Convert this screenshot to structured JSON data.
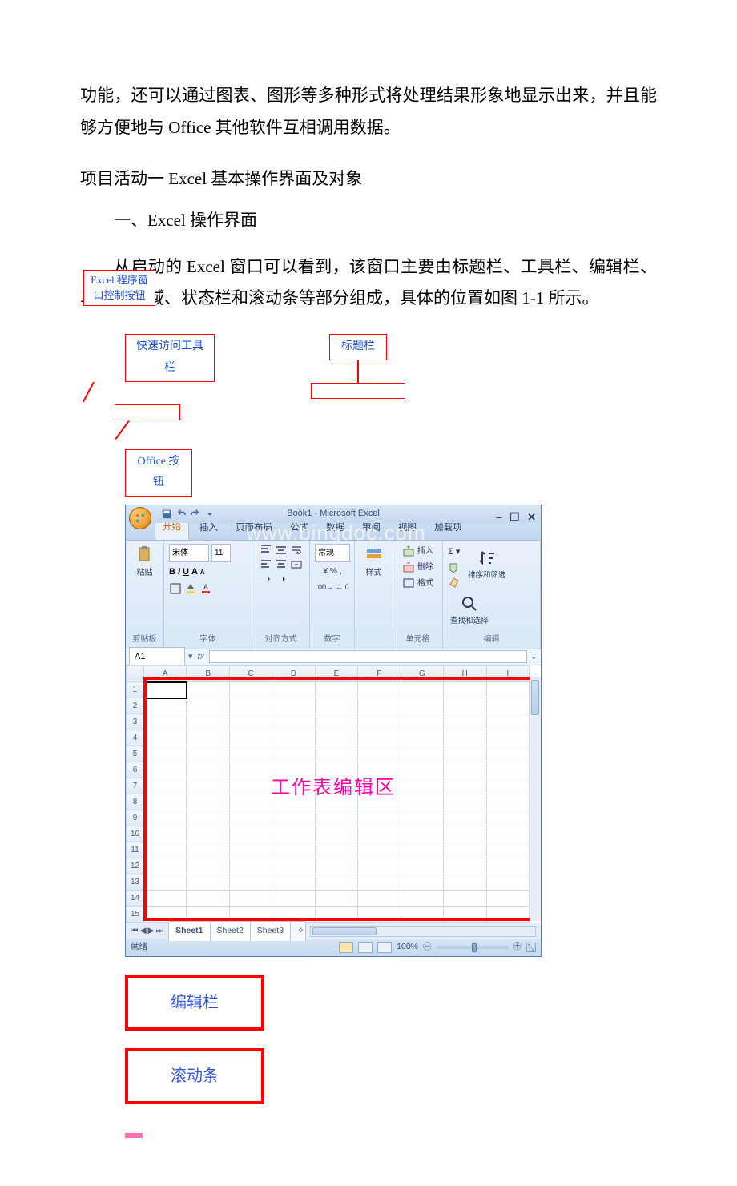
{
  "para1": "功能，还可以通过图表、图形等多种形式将处理结果形象地显示出来，并且能够方便地与 Office 其他软件互相调用数据。",
  "h1": "项目活动一 Excel 基本操作界面及对象",
  "h2": "一、Excel 操作界面",
  "para2": "从启动的 Excel 窗口可以看到，该窗口主要由标题栏、工具栏、编辑栏、单元格区域、状态栏和滚动条等部分组成，具体的位置如图 1-1 所示。",
  "annotations": {
    "program_ctrl": [
      "Excel 程序窗",
      "口控制按钮"
    ],
    "qat": "快速访问工具栏",
    "title": "标题栏",
    "office_btn": "Office 按钮",
    "edit_area": "工作表编辑区",
    "formula_bar": "编辑栏",
    "scrollbar": "滚动条"
  },
  "excel": {
    "window_title": "Book1 - Microsoft Excel",
    "tabs": [
      "开始",
      "插入",
      "页面布局",
      "公式",
      "数据",
      "审阅",
      "视图",
      "加载项"
    ],
    "active_tab": "开始",
    "groups": {
      "clipboard": {
        "label": "剪贴板",
        "paste": "粘贴"
      },
      "font": {
        "label": "字体",
        "name": "宋体",
        "size": "11",
        "btns": [
          "B",
          "I",
          "U"
        ]
      },
      "align": {
        "label": "对齐方式"
      },
      "number": {
        "label": "数字",
        "btns": [
          "常规",
          "%",
          ","
        ],
        "general": "常规"
      },
      "styles": {
        "label": "样式",
        "btn": "样式"
      },
      "cells": {
        "label": "单元格",
        "insert": "插入",
        "delete": "删除",
        "format": "格式"
      },
      "editing": {
        "label": "编辑",
        "sort": "排序和筛选",
        "find": "查找和选择"
      }
    },
    "name_box": "A1",
    "columns": [
      "A",
      "B",
      "C",
      "D",
      "E",
      "F",
      "G",
      "H",
      "I"
    ],
    "rows": [
      "1",
      "2",
      "3",
      "4",
      "5",
      "6",
      "7",
      "8",
      "9",
      "10",
      "11",
      "12",
      "13",
      "14",
      "15"
    ],
    "sheets": [
      "Sheet1",
      "Sheet2",
      "Sheet3"
    ],
    "status": "就绪",
    "zoom": "100%",
    "watermark": "www.bingdoc.com"
  }
}
